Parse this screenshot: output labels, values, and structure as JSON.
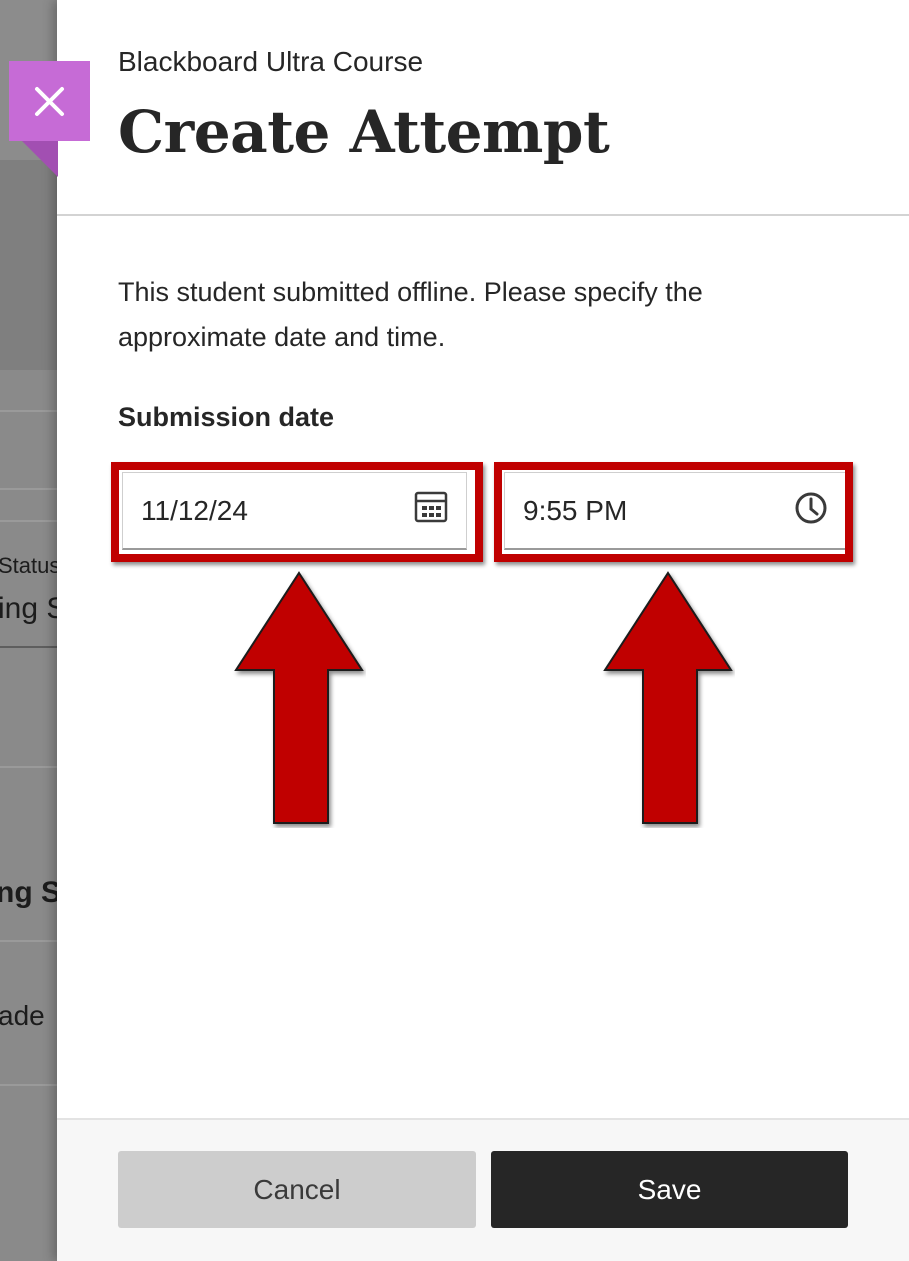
{
  "background": {
    "status_header": "Status",
    "status_value": "ing S",
    "row_label_bold": "ng St",
    "row_label": "ade"
  },
  "panel": {
    "course_name": "Blackboard Ultra Course",
    "title": "Create Attempt",
    "instructions": "This student submitted offline. Please specify the approximate date and time.",
    "field_label": "Submission date",
    "date_value": "11/12/24",
    "time_value": "9:55 PM",
    "cancel_label": "Cancel",
    "save_label": "Save"
  },
  "icons": {
    "close": "close-icon",
    "calendar": "calendar-icon",
    "clock": "clock-icon"
  },
  "colors": {
    "accent_close_tab": "#c66bd6",
    "highlight": "#c00000",
    "primary_button": "#262626",
    "secondary_button": "#cdcdcd"
  }
}
